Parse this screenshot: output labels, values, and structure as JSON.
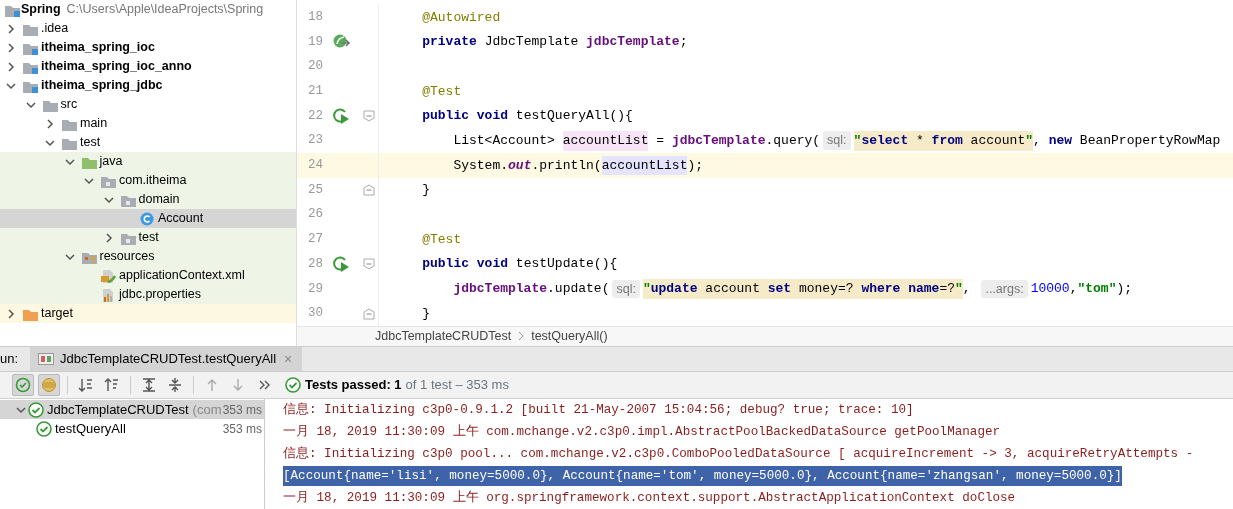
{
  "project": {
    "name": "Spring",
    "path": "C:\\Users\\Apple\\IdeaProjects\\Spring"
  },
  "tree": [
    {
      "label": ".idea",
      "kind": "folder",
      "expanded": false,
      "selected": false
    },
    {
      "label": "itheima_spring_ioc",
      "kind": "module",
      "expanded": false,
      "selected": false
    },
    {
      "label": "itheima_spring_ioc_anno",
      "kind": "module",
      "expanded": false,
      "selected": false
    },
    {
      "label": "itheima_spring_jdbc",
      "kind": "module",
      "expanded": true,
      "selected": false,
      "children": [
        {
          "label": "src",
          "kind": "folder",
          "expanded": true,
          "selected": false,
          "children": [
            {
              "label": "main",
              "kind": "folder",
              "expanded": false,
              "selected": false
            },
            {
              "label": "test",
              "kind": "folder",
              "expanded": true,
              "selected": false,
              "children": [
                {
                  "label": "java",
                  "kind": "test-root",
                  "test_source": true,
                  "expanded": true,
                  "selected": false,
                  "children": [
                    {
                      "label": "com.itheima",
                      "kind": "package",
                      "test_source": true,
                      "expanded": true,
                      "selected": false,
                      "children": [
                        {
                          "label": "domain",
                          "kind": "package",
                          "test_source": true,
                          "expanded": true,
                          "selected": false,
                          "children": [
                            {
                              "label": "Account",
                              "kind": "class",
                              "test_source": true,
                              "selected": true
                            }
                          ]
                        },
                        {
                          "label": "test",
                          "kind": "package",
                          "test_source": true,
                          "expanded": false,
                          "selected": false
                        }
                      ]
                    }
                  ]
                },
                {
                  "label": "resources",
                  "kind": "resources",
                  "test_source": true,
                  "expanded": true,
                  "selected": false,
                  "children": [
                    {
                      "label": "applicationContext.xml",
                      "kind": "xml",
                      "test_source": true,
                      "selected": false
                    },
                    {
                      "label": "jdbc.properties",
                      "kind": "properties",
                      "test_source": true,
                      "selected": false
                    }
                  ]
                }
              ]
            }
          ]
        }
      ]
    },
    {
      "label": "target",
      "kind": "excluded-folder",
      "excluded": true,
      "expanded": false,
      "selected": false
    }
  ],
  "editor": {
    "lines": [
      {
        "number": "18",
        "tokens": [
          {
            "text": "    @Autowired",
            "kind": "annotation"
          }
        ]
      },
      {
        "number": "19",
        "bean_marker": true,
        "tokens": [
          {
            "text": "    private",
            "kind": "kw"
          },
          {
            "text": " JdbcTemplate ",
            "kind": "plain"
          },
          {
            "text": "jdbcTemplate",
            "kind": "field"
          },
          {
            "text": ";",
            "kind": "plain"
          }
        ]
      },
      {
        "number": "20"
      },
      {
        "number": "21",
        "tokens": [
          {
            "text": "    @Test",
            "kind": "annotation"
          }
        ]
      },
      {
        "number": "22",
        "run_marker": true,
        "fold_start": true,
        "tokens": [
          {
            "text": "    public void",
            "kind": "kw"
          },
          {
            "text": " testQueryAll(){",
            "kind": "plain"
          }
        ]
      },
      {
        "number": "23",
        "tokens": [
          {
            "text": "        List<Account> ",
            "kind": "plain"
          },
          {
            "text": "accountList",
            "kind": "plain",
            "write_usage": true
          },
          {
            "text": " = ",
            "kind": "plain"
          },
          {
            "text": "jdbcTemplate",
            "kind": "field"
          },
          {
            "text": ".query(",
            "kind": "plain"
          },
          {
            "text": "sql:",
            "kind": "hint"
          },
          {
            "text": "\"",
            "kind": "string",
            "sql_highlight": true
          },
          {
            "text": "select",
            "kind": "kw",
            "sql_highlight": true
          },
          {
            "text": " * ",
            "kind": "plain",
            "sql_highlight": true
          },
          {
            "text": "from",
            "kind": "kw",
            "sql_highlight": true
          },
          {
            "text": " account",
            "kind": "plain",
            "sql_highlight": true
          },
          {
            "text": "\"",
            "kind": "string",
            "sql_highlight": true
          },
          {
            "text": ", ",
            "kind": "plain"
          },
          {
            "text": "new",
            "kind": "kw"
          },
          {
            "text": " BeanPropertyRowMap",
            "kind": "plain"
          }
        ]
      },
      {
        "number": "24",
        "current": true,
        "tokens": [
          {
            "text": "        System.",
            "kind": "plain"
          },
          {
            "text": "out",
            "kind": "static"
          },
          {
            "text": ".println(",
            "kind": "plain"
          },
          {
            "text": "accountList",
            "kind": "plain",
            "read_usage": true
          },
          {
            "text": ");",
            "kind": "plain"
          }
        ]
      },
      {
        "number": "25",
        "fold_end": true,
        "tokens": [
          {
            "text": "    }",
            "kind": "plain"
          }
        ]
      },
      {
        "number": "26"
      },
      {
        "number": "27",
        "tokens": [
          {
            "text": "    @Test",
            "kind": "annotation"
          }
        ]
      },
      {
        "number": "28",
        "run_marker": true,
        "fold_start": true,
        "tokens": [
          {
            "text": "    public void",
            "kind": "kw"
          },
          {
            "text": " testUpdate(){",
            "kind": "plain"
          }
        ]
      },
      {
        "number": "29",
        "tokens": [
          {
            "text": "        jdbcTemplate",
            "kind": "field"
          },
          {
            "text": ".update(",
            "kind": "plain"
          },
          {
            "text": "sql:",
            "kind": "hint"
          },
          {
            "text": "\"",
            "kind": "string",
            "sql_highlight": true
          },
          {
            "text": "update",
            "kind": "kw",
            "sql_highlight": true
          },
          {
            "text": " account ",
            "kind": "plain",
            "sql_highlight": true
          },
          {
            "text": "set",
            "kind": "kw",
            "sql_highlight": true
          },
          {
            "text": " money=? ",
            "kind": "plain",
            "sql_highlight": true
          },
          {
            "text": "where name",
            "kind": "kw",
            "sql_highlight": true
          },
          {
            "text": "=?",
            "kind": "plain",
            "sql_highlight": true
          },
          {
            "text": "\"",
            "kind": "string",
            "sql_highlight": true
          },
          {
            "text": ", ",
            "kind": "plain"
          },
          {
            "text": "...args:",
            "kind": "hint"
          },
          {
            "text": "10000",
            "kind": "number"
          },
          {
            "text": ",",
            "kind": "plain"
          },
          {
            "text": "\"tom\"",
            "kind": "string"
          },
          {
            "text": ");",
            "kind": "plain"
          }
        ]
      },
      {
        "number": "30",
        "fold_end": true,
        "tokens": [
          {
            "text": "    }",
            "kind": "plain"
          }
        ]
      }
    ],
    "breadcrumb": [
      "JdbcTemplateCRUDTest",
      "testQueryAll()"
    ]
  },
  "run": {
    "label": "un:",
    "tab": {
      "title": "JdbcTemplateCRUDTest.testQueryAll",
      "close": "×"
    },
    "toolbar": [
      {
        "kind": "show-passed",
        "on": true,
        "disabled": false
      },
      {
        "kind": "show-ignored",
        "on": true,
        "disabled": false
      },
      {
        "kind": "sort-alpha",
        "on": false,
        "disabled": false
      },
      {
        "kind": "sort-duration",
        "on": false,
        "disabled": false
      },
      {
        "kind": "expand-all",
        "on": false,
        "disabled": false
      },
      {
        "kind": "collapse-all",
        "on": false,
        "disabled": false
      },
      {
        "kind": "previous",
        "on": false,
        "disabled": true
      },
      {
        "kind": "next",
        "on": false,
        "disabled": true
      },
      {
        "kind": "more",
        "on": false,
        "disabled": false
      }
    ],
    "status": {
      "summary": "Tests passed: 1",
      "detail": "of 1 test – 353 ms"
    },
    "tests": [
      {
        "name": "JdbcTemplateCRUDTest",
        "detail": "(com",
        "time": "353 ms",
        "expanded": true,
        "selected": true,
        "children": [
          {
            "name": "testQueryAll",
            "time": "353 ms",
            "selected": false
          }
        ]
      }
    ],
    "console": [
      {
        "text": "信息: Initializing c3p0-0.9.1.2 [built 21-May-2007 15:04:56; debug? true; trace: 10]",
        "selected": false
      },
      {
        "text": "一月 18, 2019 11:30:09 上午 com.mchange.v2.c3p0.impl.AbstractPoolBackedDataSource getPoolManager",
        "selected": false
      },
      {
        "text": "信息: Initializing c3p0 pool... com.mchange.v2.c3p0.ComboPooledDataSource [ acquireIncrement -> 3, acquireRetryAttempts -",
        "selected": false
      },
      {
        "text": "[Account{name='lisi', money=5000.0}, Account{name='tom', money=5000.0}, Account{name='zhangsan', money=5000.0}]",
        "selected": true
      },
      {
        "text": "一月 18, 2019 11:30:09 上午 org.springframework.context.support.AbstractApplicationContext doClose",
        "selected": false
      }
    ]
  }
}
